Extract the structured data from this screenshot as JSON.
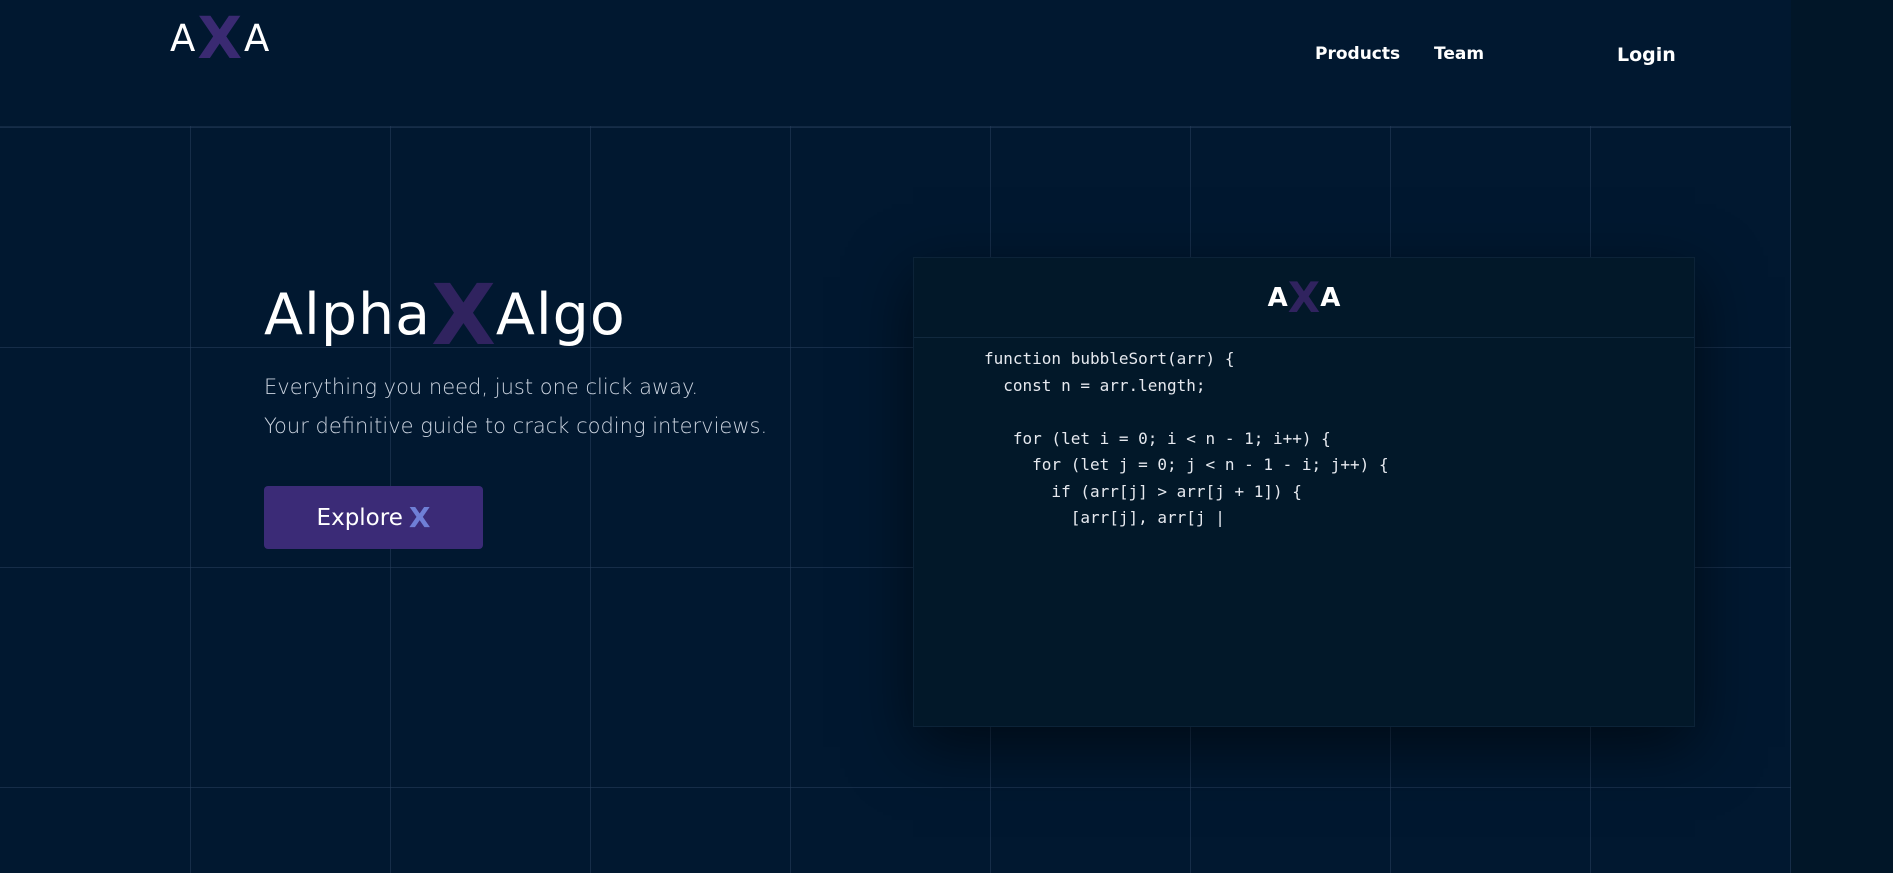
{
  "header": {
    "logo": {
      "left": "A",
      "mark": "X",
      "right": "A"
    },
    "nav": {
      "products": "Products",
      "team": "Team",
      "login": "Login"
    }
  },
  "hero": {
    "title": {
      "before": "Alpha",
      "mark": "X",
      "after": "Algo"
    },
    "tagline_1": "Everything you need, just one click away.",
    "tagline_2": "Your definitive guide to crack coding interviews.",
    "cta": {
      "label": "Explore",
      "mark": "X"
    }
  },
  "code_card": {
    "logo": {
      "left": "A",
      "mark": "X",
      "right": "A"
    },
    "code": "function bubbleSort(arr) {\n  const n = arr.length;\n\n   for (let i = 0; i < n - 1; i++) {\n     for (let j = 0; j < n - 1 - i; j++) {\n       if (arr[j] > arr[j + 1]) {\n         [arr[j], arr[j |"
  },
  "colors": {
    "background": "#011830",
    "accent_purple": "#3b2b77",
    "logo_x": "#30235f",
    "cta_x": "#6f7fd6"
  }
}
